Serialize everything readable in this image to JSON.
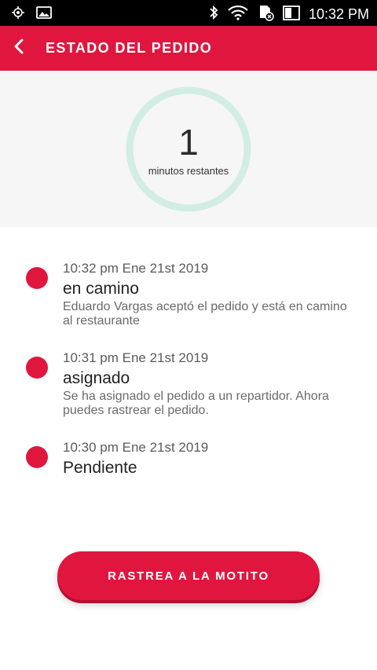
{
  "status_bar": {
    "time": "10:32 PM",
    "icons": [
      "gps-icon",
      "image-icon",
      "bluetooth-icon",
      "wifi-icon",
      "sd-card-icon",
      "battery-icon"
    ]
  },
  "header": {
    "title": "ESTADO DEL PEDIDO",
    "back_icon": "chevron-left-icon"
  },
  "timer": {
    "value": "1",
    "label": "minutos restantes"
  },
  "timeline": [
    {
      "timestamp": "10:32 pm Ene 21st 2019",
      "status": "en camino",
      "description": "Eduardo Vargas aceptó el pedido y está en camino al restaurante"
    },
    {
      "timestamp": "10:31 pm Ene 21st 2019",
      "status": "asignado",
      "description": "Se ha asignado el pedido a un repartidor. Ahora puedes rastrear el pedido."
    },
    {
      "timestamp": "10:30 pm Ene 21st 2019",
      "status": "Pendiente",
      "description": ""
    }
  ],
  "action": {
    "track_label": "RASTREA A LA MOTITO"
  },
  "colors": {
    "brand": "#e0163e",
    "ring": "#d2ede4"
  }
}
